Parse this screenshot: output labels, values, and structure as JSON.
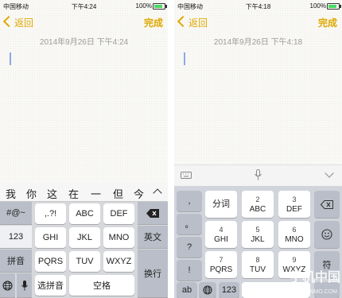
{
  "left": {
    "status": {
      "carrier": "中国移动",
      "time": "下午4:24",
      "battery": "100%"
    },
    "nav": {
      "back": "返回",
      "done": "完成"
    },
    "date": "2014年9月26日 下午4:24",
    "candidates": [
      "我",
      "你",
      "这",
      "在",
      "一",
      "但",
      "今"
    ],
    "keys": {
      "sym": "#@~",
      "punct": ",.?!",
      "abc": "ABC",
      "def": "DEF",
      "num": "123",
      "ghi": "GHI",
      "jkl": "JKL",
      "mno": "MNO",
      "en": "英文",
      "pinyin": "拼音",
      "pqrs": "PQRS",
      "tuv": "TUV",
      "wxyz": "WXYZ",
      "choose": "选拼音",
      "space": "空格",
      "return": "换行"
    }
  },
  "right": {
    "status": {
      "carrier": "中国移动",
      "time": "下午4:18",
      "battery": "100%"
    },
    "nav": {
      "back": "返回",
      "done": "完成"
    },
    "date": "2014年9月26日 下午4:18",
    "keys": {
      "comma": ",",
      "period": "。",
      "question": "?",
      "exclaim": "!",
      "fenci": "分词",
      "abc": "ABC",
      "def": "DEF",
      "ghi": "GHI",
      "jkl": "JKL",
      "mno": "MNO",
      "pqrs": "PQRS",
      "tuv": "TUV",
      "wxyz": "WXYZ",
      "fu": "符",
      "ab": "ab",
      "num": "123",
      "n2": "2",
      "n3": "3",
      "n4": "4",
      "n5": "5",
      "n6": "6",
      "n7": "7",
      "n8": "8",
      "n9": "9"
    },
    "watermark": "手机中国",
    "watermark_sub": "CNMO.COM"
  }
}
